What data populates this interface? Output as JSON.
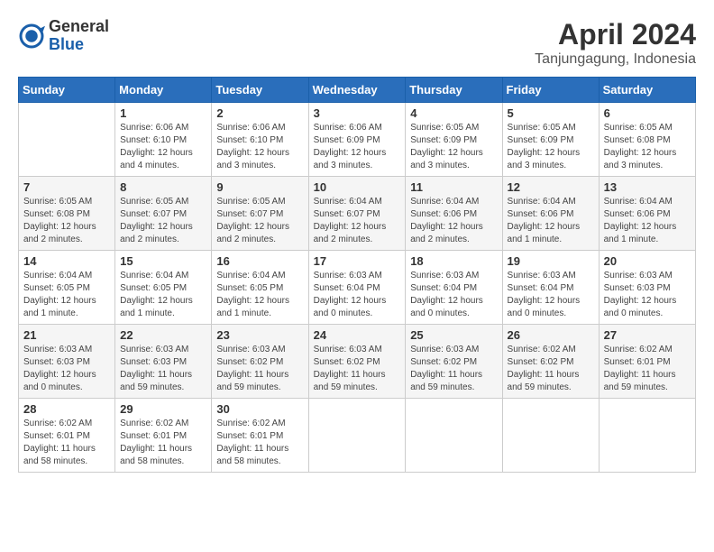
{
  "header": {
    "logo": {
      "general": "General",
      "blue": "Blue"
    },
    "title": "April 2024",
    "location": "Tanjungagung, Indonesia"
  },
  "days_of_week": [
    "Sunday",
    "Monday",
    "Tuesday",
    "Wednesday",
    "Thursday",
    "Friday",
    "Saturday"
  ],
  "weeks": [
    [
      {
        "day": "",
        "info": ""
      },
      {
        "day": "1",
        "info": "Sunrise: 6:06 AM\nSunset: 6:10 PM\nDaylight: 12 hours\nand 4 minutes."
      },
      {
        "day": "2",
        "info": "Sunrise: 6:06 AM\nSunset: 6:10 PM\nDaylight: 12 hours\nand 3 minutes."
      },
      {
        "day": "3",
        "info": "Sunrise: 6:06 AM\nSunset: 6:09 PM\nDaylight: 12 hours\nand 3 minutes."
      },
      {
        "day": "4",
        "info": "Sunrise: 6:05 AM\nSunset: 6:09 PM\nDaylight: 12 hours\nand 3 minutes."
      },
      {
        "day": "5",
        "info": "Sunrise: 6:05 AM\nSunset: 6:09 PM\nDaylight: 12 hours\nand 3 minutes."
      },
      {
        "day": "6",
        "info": "Sunrise: 6:05 AM\nSunset: 6:08 PM\nDaylight: 12 hours\nand 3 minutes."
      }
    ],
    [
      {
        "day": "7",
        "info": "Sunrise: 6:05 AM\nSunset: 6:08 PM\nDaylight: 12 hours\nand 2 minutes."
      },
      {
        "day": "8",
        "info": "Sunrise: 6:05 AM\nSunset: 6:07 PM\nDaylight: 12 hours\nand 2 minutes."
      },
      {
        "day": "9",
        "info": "Sunrise: 6:05 AM\nSunset: 6:07 PM\nDaylight: 12 hours\nand 2 minutes."
      },
      {
        "day": "10",
        "info": "Sunrise: 6:04 AM\nSunset: 6:07 PM\nDaylight: 12 hours\nand 2 minutes."
      },
      {
        "day": "11",
        "info": "Sunrise: 6:04 AM\nSunset: 6:06 PM\nDaylight: 12 hours\nand 2 minutes."
      },
      {
        "day": "12",
        "info": "Sunrise: 6:04 AM\nSunset: 6:06 PM\nDaylight: 12 hours\nand 1 minute."
      },
      {
        "day": "13",
        "info": "Sunrise: 6:04 AM\nSunset: 6:06 PM\nDaylight: 12 hours\nand 1 minute."
      }
    ],
    [
      {
        "day": "14",
        "info": "Sunrise: 6:04 AM\nSunset: 6:05 PM\nDaylight: 12 hours\nand 1 minute."
      },
      {
        "day": "15",
        "info": "Sunrise: 6:04 AM\nSunset: 6:05 PM\nDaylight: 12 hours\nand 1 minute."
      },
      {
        "day": "16",
        "info": "Sunrise: 6:04 AM\nSunset: 6:05 PM\nDaylight: 12 hours\nand 1 minute."
      },
      {
        "day": "17",
        "info": "Sunrise: 6:03 AM\nSunset: 6:04 PM\nDaylight: 12 hours\nand 0 minutes."
      },
      {
        "day": "18",
        "info": "Sunrise: 6:03 AM\nSunset: 6:04 PM\nDaylight: 12 hours\nand 0 minutes."
      },
      {
        "day": "19",
        "info": "Sunrise: 6:03 AM\nSunset: 6:04 PM\nDaylight: 12 hours\nand 0 minutes."
      },
      {
        "day": "20",
        "info": "Sunrise: 6:03 AM\nSunset: 6:03 PM\nDaylight: 12 hours\nand 0 minutes."
      }
    ],
    [
      {
        "day": "21",
        "info": "Sunrise: 6:03 AM\nSunset: 6:03 PM\nDaylight: 12 hours\nand 0 minutes."
      },
      {
        "day": "22",
        "info": "Sunrise: 6:03 AM\nSunset: 6:03 PM\nDaylight: 11 hours\nand 59 minutes."
      },
      {
        "day": "23",
        "info": "Sunrise: 6:03 AM\nSunset: 6:02 PM\nDaylight: 11 hours\nand 59 minutes."
      },
      {
        "day": "24",
        "info": "Sunrise: 6:03 AM\nSunset: 6:02 PM\nDaylight: 11 hours\nand 59 minutes."
      },
      {
        "day": "25",
        "info": "Sunrise: 6:03 AM\nSunset: 6:02 PM\nDaylight: 11 hours\nand 59 minutes."
      },
      {
        "day": "26",
        "info": "Sunrise: 6:02 AM\nSunset: 6:02 PM\nDaylight: 11 hours\nand 59 minutes."
      },
      {
        "day": "27",
        "info": "Sunrise: 6:02 AM\nSunset: 6:01 PM\nDaylight: 11 hours\nand 59 minutes."
      }
    ],
    [
      {
        "day": "28",
        "info": "Sunrise: 6:02 AM\nSunset: 6:01 PM\nDaylight: 11 hours\nand 58 minutes."
      },
      {
        "day": "29",
        "info": "Sunrise: 6:02 AM\nSunset: 6:01 PM\nDaylight: 11 hours\nand 58 minutes."
      },
      {
        "day": "30",
        "info": "Sunrise: 6:02 AM\nSunset: 6:01 PM\nDaylight: 11 hours\nand 58 minutes."
      },
      {
        "day": "",
        "info": ""
      },
      {
        "day": "",
        "info": ""
      },
      {
        "day": "",
        "info": ""
      },
      {
        "day": "",
        "info": ""
      }
    ]
  ]
}
